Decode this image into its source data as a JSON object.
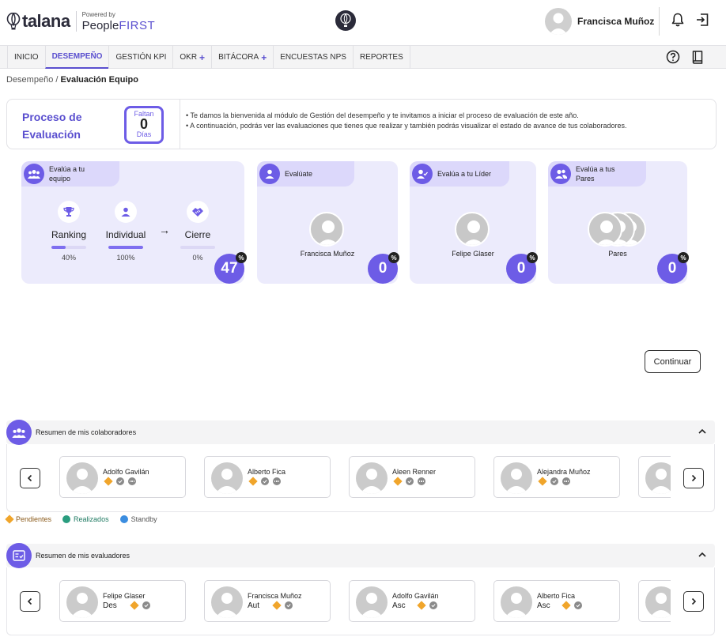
{
  "header": {
    "logo_text": "talana",
    "powered_by": "Powered by",
    "brand_people": "People",
    "brand_first": "FIRST",
    "user_name": "Francisca Muñoz"
  },
  "nav": {
    "items": [
      {
        "label": "INICIO",
        "plus": ""
      },
      {
        "label": "DESEMPEÑO",
        "plus": ""
      },
      {
        "label": "GESTIÓN KPI",
        "plus": ""
      },
      {
        "label": "OKR",
        "plus": "+"
      },
      {
        "label": "BITÁCORA",
        "plus": "+"
      },
      {
        "label": "ENCUESTAS NPS",
        "plus": ""
      },
      {
        "label": "REPORTES",
        "plus": ""
      }
    ],
    "active": "DESEMPEÑO"
  },
  "breadcrumb": {
    "parent": "Desempeño",
    "separator": "/",
    "current": "Evaluación Equipo"
  },
  "process": {
    "title_line1": "Proceso de",
    "title_line2": "Evaluación",
    "faltan": "Faltan",
    "days": "0",
    "dias": "Días",
    "text_line1": "• Te damos la bienvenida al módulo de Gestión del desempeño y te invitamos a iniciar el proceso de evaluación de este año.",
    "text_line2": "• A continuación, podrás ver las evaluaciones que tienes que realizar y también podrás visualizar el estado de avance de tus colaboradores."
  },
  "cards": {
    "team": {
      "tag_line1": "Evalúa a tu",
      "tag_line2": "equipo",
      "percent": "47",
      "badge": "%",
      "stages": [
        {
          "label": "Ranking",
          "pct_text": "40%",
          "value": 0.4
        },
        {
          "label": "Individual",
          "pct_text": "100%",
          "value": 1.0
        },
        {
          "label": "Cierre",
          "pct_text": "0%",
          "value": 0
        }
      ],
      "arrow": "→"
    },
    "self": {
      "tag": "Evalúate",
      "name": "Francisca Muñoz",
      "percent": "0",
      "badge": "%"
    },
    "leader": {
      "tag": "Evalúa a tu Líder",
      "name": "Felipe Glaser",
      "percent": "0",
      "badge": "%"
    },
    "peers": {
      "tag_line1": "Evalúa a tus",
      "tag_line2": "Pares",
      "name": "Pares",
      "percent": "0",
      "badge": "%"
    }
  },
  "continue_label": "Continuar",
  "collaborators": {
    "title": "Resumen de mis colaboradores",
    "people": [
      {
        "name": "Adolfo Gavilán"
      },
      {
        "name": "Alberto Fica"
      },
      {
        "name": "Aleen Renner"
      },
      {
        "name": "Alejandra Muñoz"
      }
    ]
  },
  "legend": {
    "pending": "Pendientes",
    "done": "Realizados",
    "standby": "Standby"
  },
  "evaluators": {
    "title": "Resumen de mis evaluadores",
    "people": [
      {
        "name": "Felipe Glaser",
        "type": "Des"
      },
      {
        "name": "Francisca Muñoz",
        "type": "Aut"
      },
      {
        "name": "Adolfo Gavilán",
        "type": "Asc"
      },
      {
        "name": "Alberto Fica",
        "type": "Asc"
      }
    ]
  },
  "colors": {
    "accent": "#6d5ce6",
    "card_bg": "#ecebfc",
    "pending": "#f0a52b",
    "done": "#2a9d7f",
    "standby": "#3b8de0"
  },
  "icons": [
    "talana-balloon-icon",
    "bell-icon",
    "logout-icon",
    "help-icon",
    "book-icon",
    "team-icon",
    "user-icon",
    "trophy-icon",
    "handshake-icon",
    "chevron-up-icon",
    "chevron-left-icon",
    "chevron-right-icon",
    "checklist-icon"
  ]
}
